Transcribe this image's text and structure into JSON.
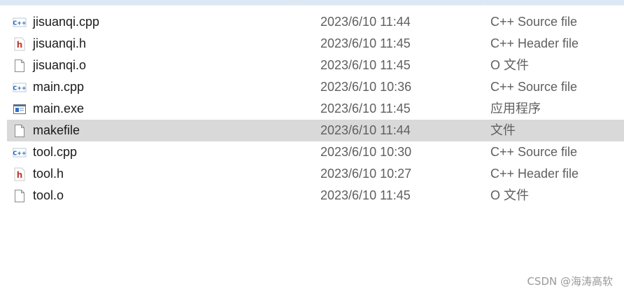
{
  "files": [
    {
      "name": "jisuanqi.cpp",
      "date": "2023/6/10 11:44",
      "type": "C++ Source file",
      "icon": "cpp-file-icon",
      "selected": false
    },
    {
      "name": "jisuanqi.h",
      "date": "2023/6/10 11:45",
      "type": "C++ Header file",
      "icon": "header-file-icon",
      "selected": false
    },
    {
      "name": "jisuanqi.o",
      "date": "2023/6/10 11:45",
      "type": "O 文件",
      "icon": "blank-file-icon",
      "selected": false
    },
    {
      "name": "main.cpp",
      "date": "2023/6/10 10:36",
      "type": "C++ Source file",
      "icon": "cpp-file-icon",
      "selected": false
    },
    {
      "name": "main.exe",
      "date": "2023/6/10 11:45",
      "type": "应用程序",
      "icon": "exe-file-icon",
      "selected": false
    },
    {
      "name": "makefile",
      "date": "2023/6/10 11:44",
      "type": "文件",
      "icon": "blank-file-icon",
      "selected": true
    },
    {
      "name": "tool.cpp",
      "date": "2023/6/10 10:30",
      "type": "C++ Source file",
      "icon": "cpp-file-icon",
      "selected": false
    },
    {
      "name": "tool.h",
      "date": "2023/6/10 10:27",
      "type": "C++ Header file",
      "icon": "header-file-icon",
      "selected": false
    },
    {
      "name": "tool.o",
      "date": "2023/6/10 11:45",
      "type": "O 文件",
      "icon": "blank-file-icon",
      "selected": false
    }
  ],
  "watermark": "CSDN @海涛高软",
  "colors": {
    "selected_row": "#d9d9d9",
    "header_strip": "#dde8f5",
    "cpp_icon_text": "#1a5fb4",
    "header_icon_text": "#c0392b"
  }
}
